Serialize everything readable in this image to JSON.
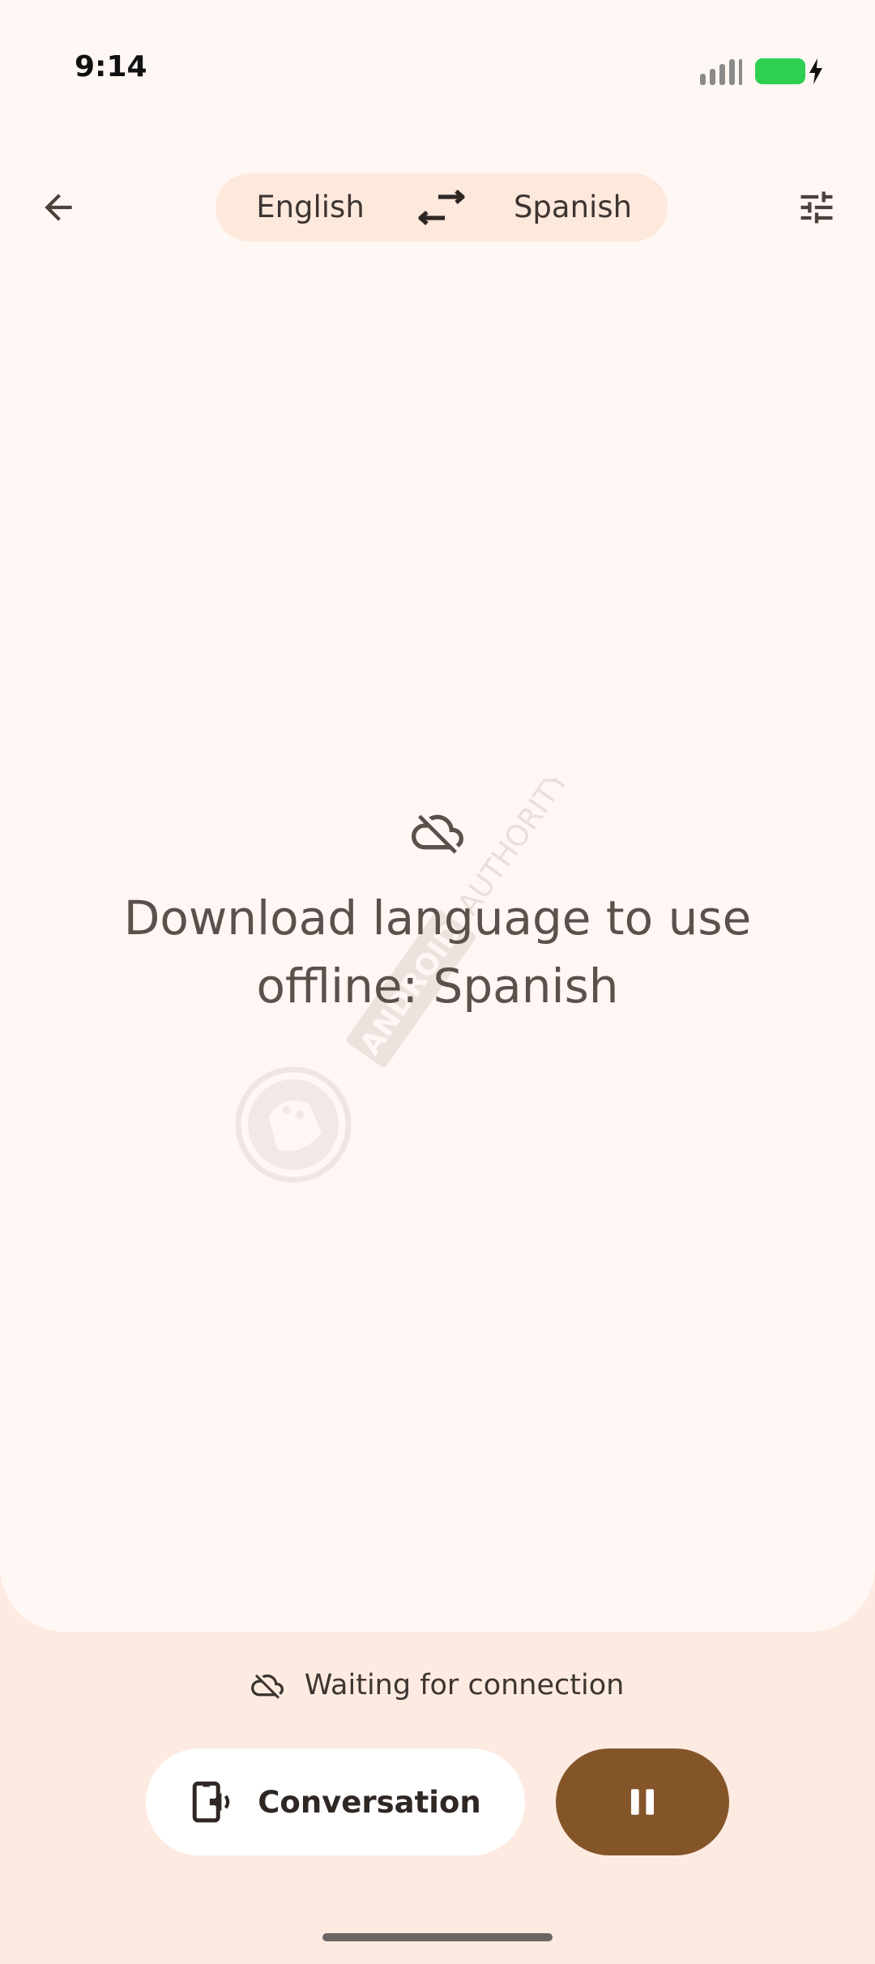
{
  "status_bar": {
    "time": "9:14"
  },
  "header": {
    "source_language": "English",
    "target_language": "Spanish"
  },
  "main": {
    "message": "Download language to use offline: Spanish"
  },
  "footer": {
    "connection_status": "Waiting for connection",
    "conversation_label": "Conversation"
  },
  "watermark": {
    "text": "ANDROID AUTHORITY"
  },
  "icons": {
    "back": "back-arrow-icon",
    "swap": "swap-arrows-icon",
    "settings": "tune-sliders-icon",
    "offline": "cloud-off-icon",
    "conversation": "speaker-phone-icon",
    "pause": "pause-icon"
  },
  "colors": {
    "background": "#fdebe1",
    "card": "#fff7f3",
    "pill": "#fde8dc",
    "accent": "#85552a",
    "battery": "#2fcf52"
  }
}
